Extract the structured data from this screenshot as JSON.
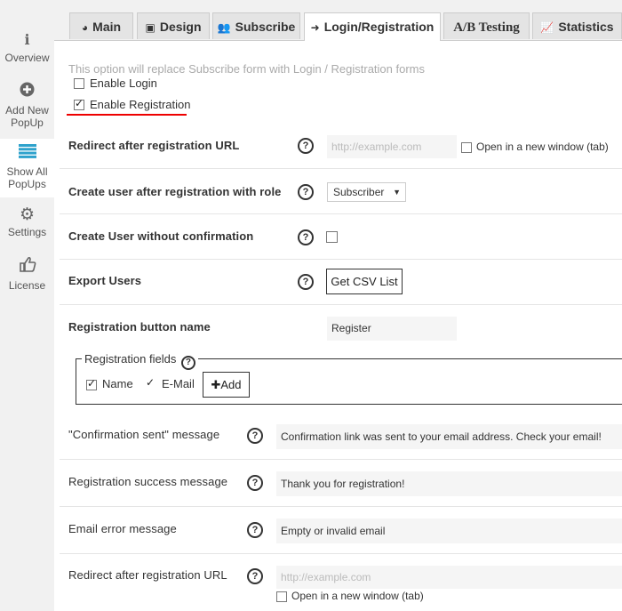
{
  "sidebar": {
    "items": [
      {
        "label": "Overview",
        "icon": "info-icon"
      },
      {
        "label": "Add New PopUp",
        "icon": "plus-circle-icon"
      },
      {
        "label": "Show All PopUps",
        "icon": "list-icon"
      },
      {
        "label": "Settings",
        "icon": "gear-icon"
      },
      {
        "label": "License",
        "icon": "thumbs-up-icon"
      }
    ]
  },
  "tabs": [
    {
      "label": "Main",
      "icon": "dashboard-icon"
    },
    {
      "label": "Design",
      "icon": "picture-icon"
    },
    {
      "label": "Subscribe",
      "icon": "users-icon"
    },
    {
      "label": "Login/Registration",
      "icon": "sign-in-icon"
    },
    {
      "label": "A/B Testing",
      "icon": "ab-icon"
    },
    {
      "label": "Statistics",
      "icon": "chart-icon"
    }
  ],
  "intro": {
    "note": "This option will replace Subscribe form with Login / Registration forms",
    "enable_login": "Enable Login",
    "enable_registration": "Enable Registration"
  },
  "settings": {
    "redirect_url_label": "Redirect after registration URL",
    "redirect_url_placeholder": "http://example.com",
    "open_new_window": "Open in a new window (tab)",
    "role_label": "Create user after registration with role",
    "role_value": "Subscriber",
    "no_confirm_label": "Create User without confirmation",
    "export_label": "Export Users",
    "export_button": "Get CSV List",
    "button_name_label": "Registration button name",
    "button_name_value": "Register"
  },
  "fields": {
    "legend": "Registration fields",
    "name": "Name",
    "email": "E-Mail",
    "add": "Add"
  },
  "messages": {
    "confirm_sent_label": "\"Confirmation sent\" message",
    "confirm_sent_value": "Confirmation link was sent to your email address. Check your email!",
    "success_label": "Registration success message",
    "success_value": "Thank you for registration!",
    "email_error_label": "Email error message",
    "email_error_value": "Empty or invalid email",
    "redirect_label": "Redirect after registration URL",
    "redirect_placeholder": "http://example.com",
    "open_new_window": "Open in a new window (tab)"
  },
  "help_glyph": "?",
  "colors": {
    "accent": "#2ea2cc",
    "highlight": "#e00000"
  }
}
